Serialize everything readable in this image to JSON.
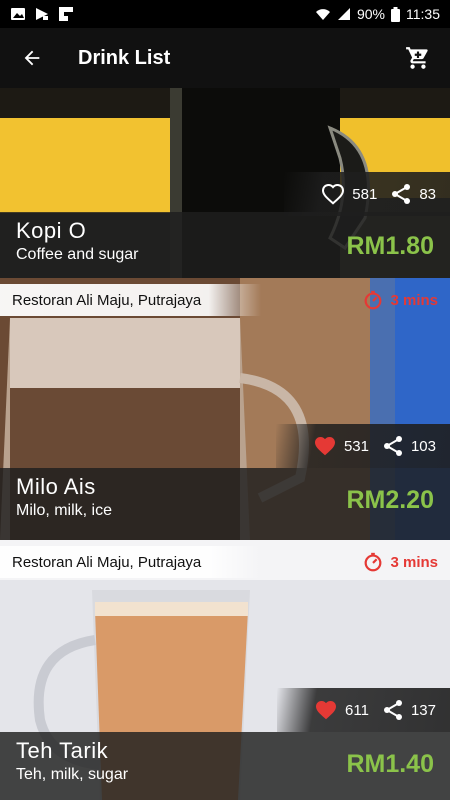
{
  "status_bar": {
    "battery": "90%",
    "time": "11:35"
  },
  "app_bar": {
    "title": "Drink List"
  },
  "drinks": [
    {
      "name": "Kopi O",
      "description": "Coffee and sugar",
      "price": "RM1.80",
      "likes": "581",
      "shares": "83",
      "liked": false
    },
    {
      "restaurant": "Restoran Ali Maju, Putrajaya",
      "time": "3 mins",
      "name": "Milo Ais",
      "description": "Milo, milk, ice",
      "price": "RM2.20",
      "likes": "531",
      "shares": "103",
      "liked": true
    },
    {
      "restaurant": "Restoran Ali Maju, Putrajaya",
      "time": "3 mins",
      "name": "Teh Tarik",
      "description": "Teh, milk, sugar",
      "price": "RM1.40",
      "likes": "611",
      "shares": "137",
      "liked": true
    }
  ],
  "colors": {
    "price": "#8bc34a",
    "time": "#e53935",
    "like_active": "#e53935"
  }
}
